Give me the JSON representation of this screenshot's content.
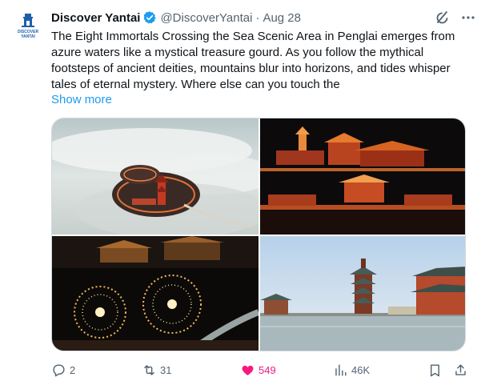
{
  "account": {
    "display_name": "Discover Yantai",
    "handle": "@DiscoverYantai",
    "separator": "·",
    "date": "Aug 28",
    "avatar_text_1": "DISCOVER",
    "avatar_text_2": "YANTAI"
  },
  "icons": {
    "verified": "verified-badge-icon",
    "grok": "grok-icon",
    "more": "more-icon",
    "reply": "reply-icon",
    "retweet": "retweet-icon",
    "like": "heart-icon",
    "views": "views-icon",
    "bookmark": "bookmark-icon",
    "share": "share-icon"
  },
  "tweet": {
    "text": "The Eight Immortals Crossing the Sea Scenic Area in Penglai emerges from azure waters like a mystical treasure gourd. As you follow the mythical footsteps of ancient deities, mountains blur into horizons, and tides whisper tales of eternal mystery. Where else can you touch the",
    "show_more": "Show more"
  },
  "media": [
    {
      "name": "aerial-penglai-in-clouds"
    },
    {
      "name": "illuminated-pavilions-at-night"
    },
    {
      "name": "molten-iron-fireworks"
    },
    {
      "name": "pagoda-by-the-sea"
    }
  ],
  "actions": {
    "replies": "2",
    "retweets": "31",
    "likes": "549",
    "views": "46K"
  },
  "colors": {
    "accent": "#1d9bf0",
    "like": "#f91880",
    "muted": "#536471",
    "text": "#0f1419"
  }
}
